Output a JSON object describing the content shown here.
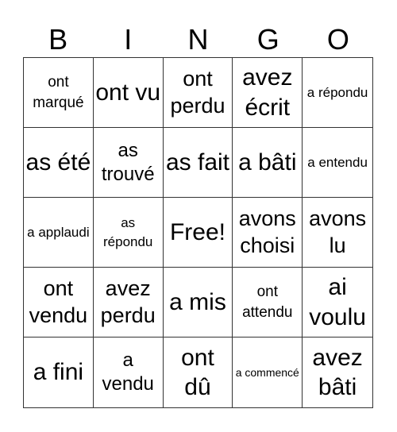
{
  "header": [
    "B",
    "I",
    "N",
    "G",
    "O"
  ],
  "cells": [
    {
      "text": "ont marqué",
      "size": "sm"
    },
    {
      "text": "ont vu",
      "size": "xl"
    },
    {
      "text": "ont perdu",
      "size": "lg"
    },
    {
      "text": "avez écrit",
      "size": "xl"
    },
    {
      "text": "a répondu",
      "size": "xs"
    },
    {
      "text": "as été",
      "size": "xl"
    },
    {
      "text": "as trouvé",
      "size": "md"
    },
    {
      "text": "as fait",
      "size": "xl"
    },
    {
      "text": "a bâti",
      "size": "xl"
    },
    {
      "text": "a entendu",
      "size": "xs"
    },
    {
      "text": "a applaudi",
      "size": "xs"
    },
    {
      "text": "as répondu",
      "size": "xs"
    },
    {
      "text": "Free!",
      "size": "xl"
    },
    {
      "text": "avons choisi",
      "size": "lg"
    },
    {
      "text": "avons lu",
      "size": "lg"
    },
    {
      "text": "ont vendu",
      "size": "lg"
    },
    {
      "text": "avez perdu",
      "size": "lg"
    },
    {
      "text": "a mis",
      "size": "xl"
    },
    {
      "text": "ont attendu",
      "size": "sm"
    },
    {
      "text": "ai voulu",
      "size": "xl"
    },
    {
      "text": "a fini",
      "size": "xl"
    },
    {
      "text": "a vendu",
      "size": "md"
    },
    {
      "text": "ont dû",
      "size": "xl"
    },
    {
      "text": "a commencé",
      "size": "xxs"
    },
    {
      "text": "avez bâti",
      "size": "xl"
    }
  ]
}
